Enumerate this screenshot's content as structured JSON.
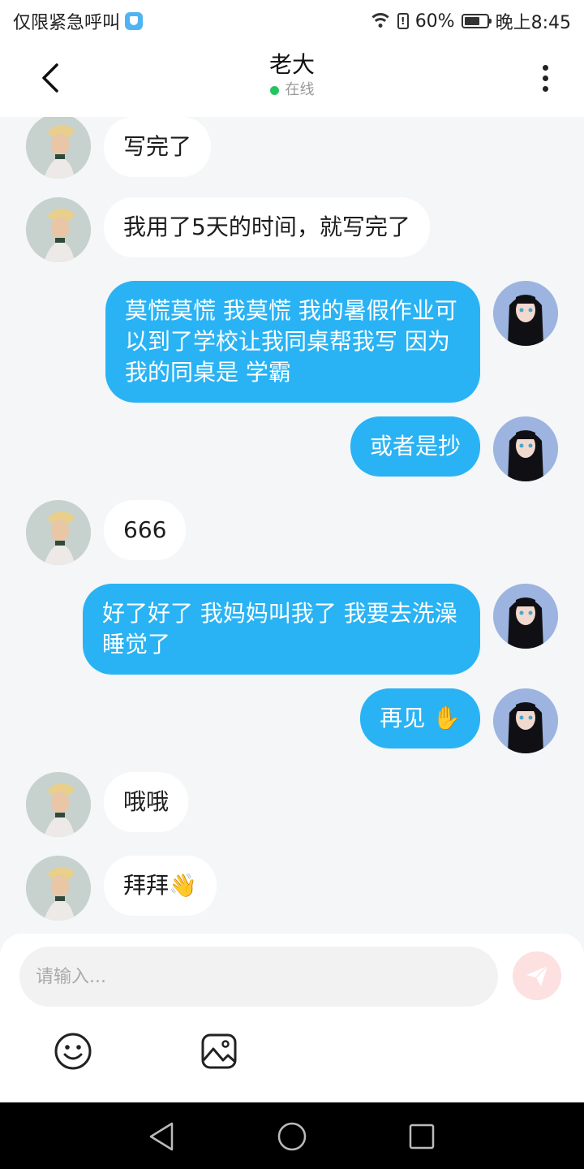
{
  "status_bar": {
    "carrier_text": "仅限紧急呼叫",
    "battery_percent": "60%",
    "time": "晚上8:45",
    "icons": [
      "shield-icon",
      "wifi-icon",
      "sim-icon",
      "battery-icon"
    ]
  },
  "header": {
    "title": "老大",
    "status": "在线",
    "status_color": "#22c55e"
  },
  "messages": [
    {
      "side": "in",
      "text": "写完了"
    },
    {
      "side": "in",
      "text": "我用了5天的时间，就写完了"
    },
    {
      "side": "out",
      "text": " 莫慌莫慌 我莫慌 我的暑假作业可以到了学校让我同桌帮我写 因为我的同桌是 学霸"
    },
    {
      "side": "out",
      "text": "或者是抄"
    },
    {
      "side": "in",
      "text": "666"
    },
    {
      "side": "out",
      "text": "好了好了 我妈妈叫我了 我要去洗澡睡觉了"
    },
    {
      "side": "out",
      "text": "再见 ✋"
    },
    {
      "side": "in",
      "text": "哦哦"
    },
    {
      "side": "in",
      "text": "拜拜👋"
    }
  ],
  "input": {
    "placeholder": "请输入..."
  },
  "colors": {
    "outgoing_bubble": "#29b3f4",
    "incoming_bubble": "#ffffff",
    "background": "#f4f6f8",
    "send_button": "#fde0e0"
  }
}
